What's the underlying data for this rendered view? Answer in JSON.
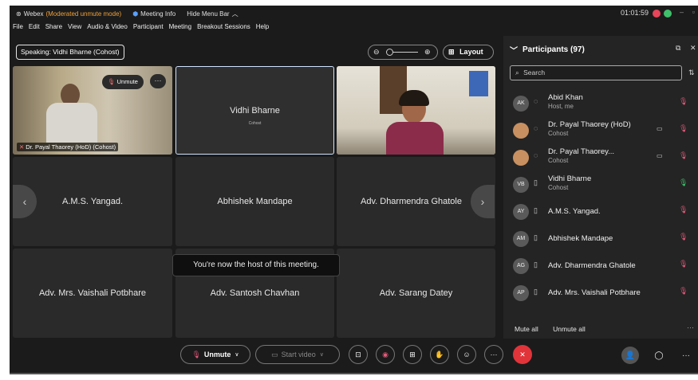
{
  "titlebar": {
    "app": "Webex",
    "mode": "(Moderated unmute mode)",
    "meeting_info": "Meeting Info",
    "hide_menu": "Hide Menu Bar",
    "clock": "01:01:59"
  },
  "menu": [
    "File",
    "Edit",
    "Share",
    "View",
    "Audio & Video",
    "Participant",
    "Meeting",
    "Breakout Sessions",
    "Help"
  ],
  "speaking": "Speaking: Vidhi Bharne (Cohost)",
  "layout_label": "Layout",
  "tiles": {
    "t1": {
      "caption": "Dr. Payal Thaorey (HoD) (Cohost)",
      "unmute": "Unmute"
    },
    "t2": {
      "name": "Vidhi Bharne",
      "sub": "Cohost"
    },
    "t4": {
      "name": "A.M.S. Yangad."
    },
    "t5": {
      "name": "Abhishek Mandape"
    },
    "t6": {
      "name": "Adv. Dharmendra Ghatole"
    },
    "t7": {
      "name": "Adv. Mrs. Vaishali Potbhare"
    },
    "t8": {
      "name": "Adv. Santosh Chavhan"
    },
    "t9": {
      "name": "Adv. Sarang Datey"
    }
  },
  "toast": "You're now the host of this meeting.",
  "panel": {
    "title": "Participants (97)",
    "search_placeholder": "Search",
    "participants": [
      {
        "initials": "AK",
        "name": "Abid Khan",
        "role": "Host, me"
      },
      {
        "initials": "",
        "name": "Dr. Payal Thaorey (HoD)",
        "role": "Cohost"
      },
      {
        "initials": "",
        "name": "Dr. Payal Thaorey...",
        "role": "Cohost"
      },
      {
        "initials": "VB",
        "name": "Vidhi Bharne",
        "role": "Cohost"
      },
      {
        "initials": "AY",
        "name": "A.M.S. Yangad.",
        "role": ""
      },
      {
        "initials": "AM",
        "name": "Abhishek Mandape",
        "role": ""
      },
      {
        "initials": "AG",
        "name": "Adv. Dharmendra Ghatole",
        "role": ""
      },
      {
        "initials": "AP",
        "name": "Adv. Mrs. Vaishali Potbhare",
        "role": ""
      }
    ],
    "mute_all": "Mute all",
    "unmute_all": "Unmute all"
  },
  "controls": {
    "unmute": "Unmute",
    "start_video": "Start video"
  },
  "colors": {
    "mode": "#f0a23a",
    "end": "#e0343a",
    "muted": "#e05a7a",
    "unmuted": "#3fbf6a"
  }
}
